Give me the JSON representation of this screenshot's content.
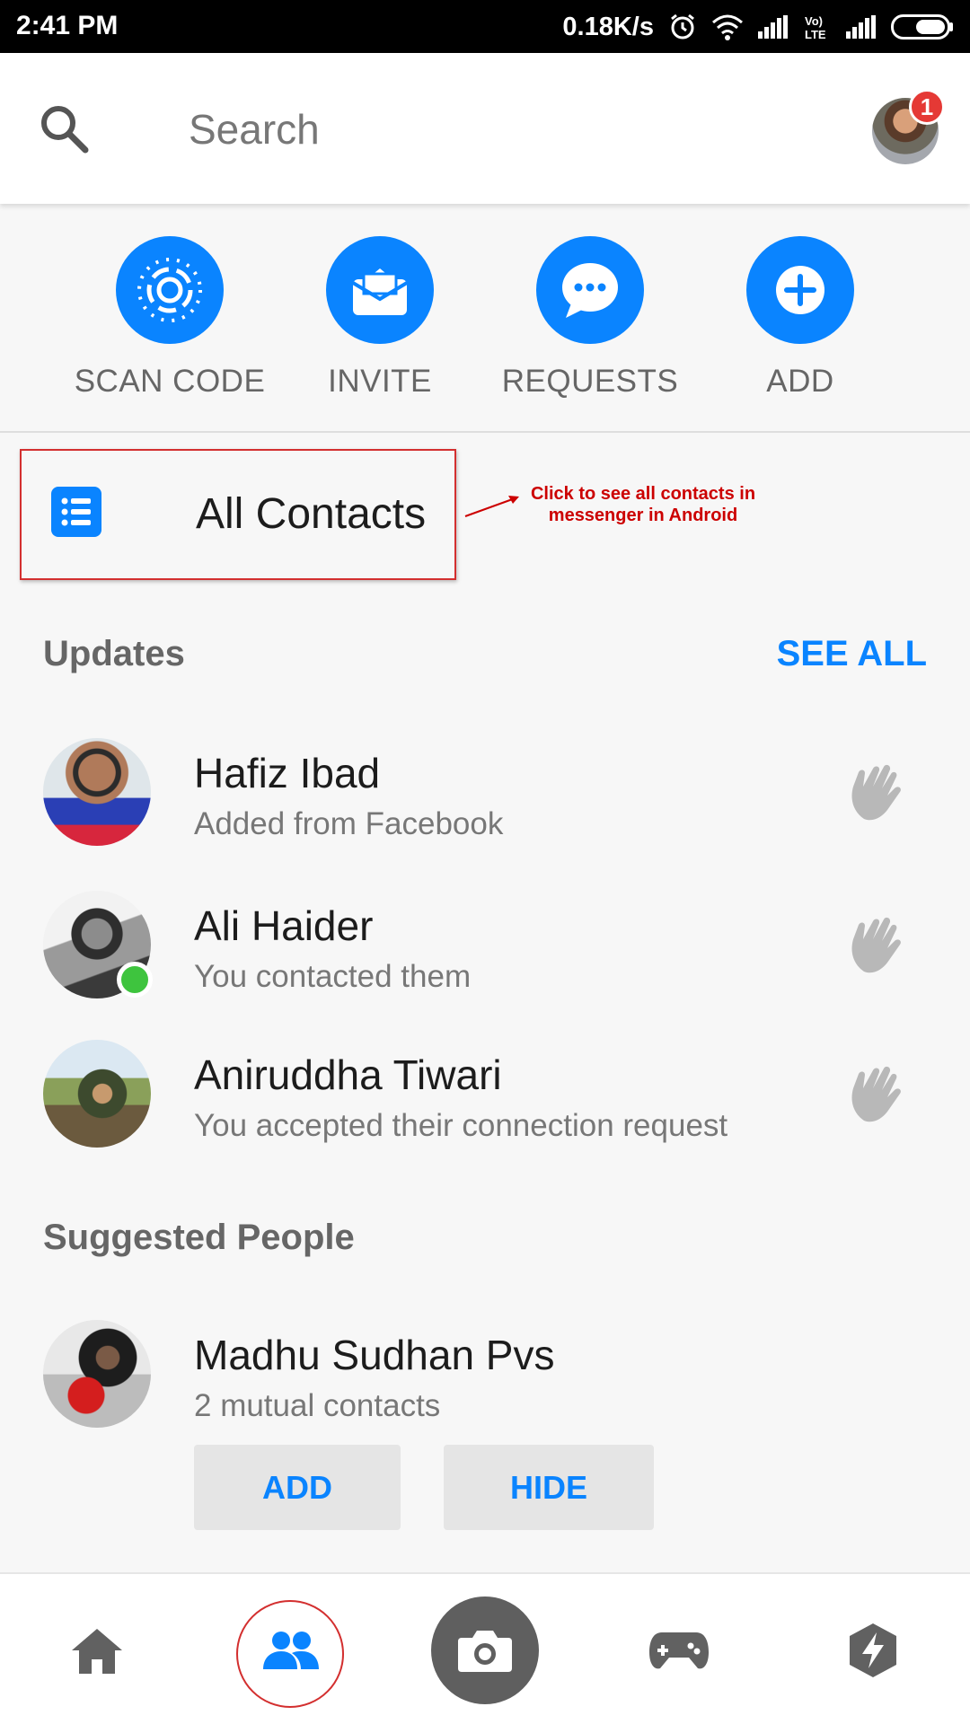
{
  "status_bar": {
    "time": "2:41 PM",
    "net_speed": "0.18K/s",
    "volte_label": "Vo)) LTE",
    "battery_icon": "battery-icon",
    "wifi_icon": "wifi-icon",
    "alarm_icon": "alarm-icon"
  },
  "search": {
    "placeholder": "Search",
    "notification_count": "1"
  },
  "actions": [
    {
      "label": "SCAN CODE",
      "icon": "scan-code-icon"
    },
    {
      "label": "INVITE",
      "icon": "invite-envelope-icon"
    },
    {
      "label": "REQUESTS",
      "icon": "requests-chat-icon"
    },
    {
      "label": "ADD",
      "icon": "add-plus-icon"
    }
  ],
  "all_contacts": {
    "label": "All Contacts",
    "annotation": "Click to see all contacts in messenger in Android"
  },
  "updates": {
    "title": "Updates",
    "see_all": "SEE ALL",
    "items": [
      {
        "name": "Hafiz Ibad",
        "subtitle": "Added from Facebook"
      },
      {
        "name": "Ali Haider",
        "subtitle": "You contacted them"
      },
      {
        "name": "Aniruddha Tiwari",
        "subtitle": "You accepted their connection request"
      }
    ]
  },
  "suggested": {
    "title": "Suggested People",
    "items": [
      {
        "name": "Madhu Sudhan Pvs",
        "subtitle": "2 mutual contacts",
        "add_label": "ADD",
        "hide_label": "HIDE"
      }
    ]
  },
  "bottom_nav": {
    "items": [
      "home-icon",
      "people-icon",
      "camera-icon",
      "games-icon",
      "discover-bolt-icon"
    ]
  },
  "colors": {
    "accent": "#0a84ff",
    "annotation": "#cc0000",
    "online": "#3ec43e",
    "badge": "#e53935"
  }
}
